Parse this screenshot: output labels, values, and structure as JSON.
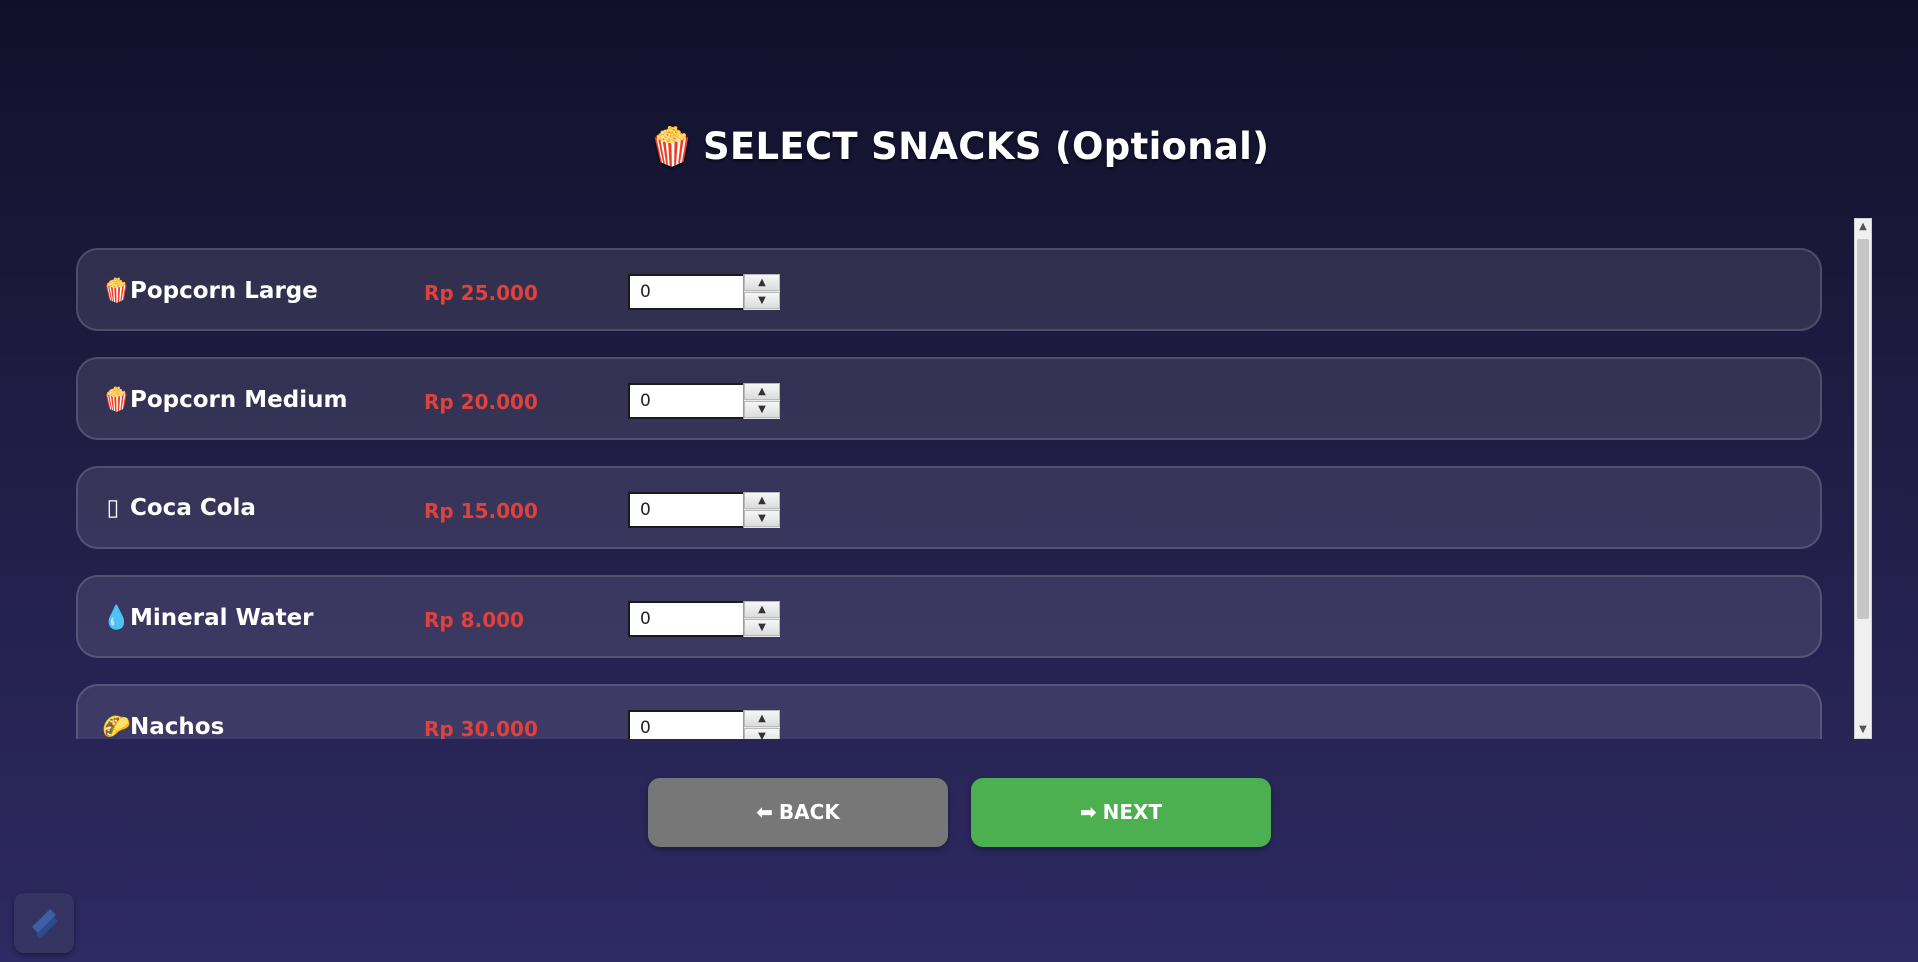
{
  "page": {
    "title_icon": "🍿",
    "title": "SELECT SNACKS (Optional)"
  },
  "snacks": [
    {
      "icon": "🍿",
      "icon_name": "popcorn-icon",
      "name": "Popcorn Large",
      "price": "Rp 25.000",
      "quantity": "0"
    },
    {
      "icon": "🍿",
      "icon_name": "popcorn-icon",
      "name": "Popcorn Medium",
      "price": "Rp 20.000",
      "quantity": "0"
    },
    {
      "icon": "▯",
      "icon_name": "cup-icon",
      "name": "Coca Cola",
      "price": "Rp 15.000",
      "quantity": "0"
    },
    {
      "icon": "💧",
      "icon_name": "droplet-icon",
      "name": "Mineral Water",
      "price": "Rp 8.000",
      "quantity": "0"
    },
    {
      "icon": "🌮",
      "icon_name": "taco-icon",
      "name": "Nachos",
      "price": "Rp 30.000",
      "quantity": "0"
    }
  ],
  "buttons": {
    "back_icon": "⬅",
    "back_label": "BACK",
    "next_icon": "➡",
    "next_label": "NEXT"
  },
  "colors": {
    "price": "#e0413a",
    "back_button": "#777777",
    "next_button": "#4caf50"
  }
}
